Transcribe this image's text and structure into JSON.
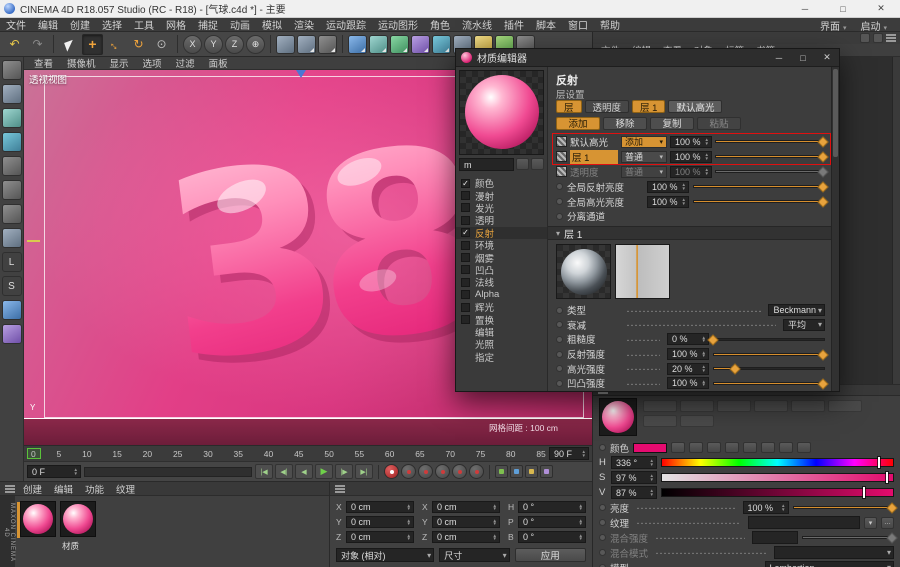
{
  "titlebar": {
    "title": "CINEMA 4D R18.057 Studio (RC - R18) - [气球.c4d *] - 主要",
    "min": "─",
    "max": "□",
    "close": "✕"
  },
  "menubar": {
    "items": [
      "文件",
      "编辑",
      "创建",
      "选择",
      "工具",
      "网格",
      "捕捉",
      "动画",
      "模拟",
      "渲染",
      "运动跟踪",
      "运动图形",
      "角色",
      "流水线",
      "插件",
      "脚本",
      "窗口",
      "帮助"
    ],
    "right_items": [
      "界面",
      "启动"
    ]
  },
  "toolbar": {
    "axis": [
      "X",
      "Y",
      "Z"
    ],
    "left_letters": [
      "L",
      "S"
    ]
  },
  "viewport": {
    "menu_items": [
      "查看",
      "摄像机",
      "显示",
      "选项",
      "过滤",
      "面板"
    ],
    "view_label": "透视视图",
    "axis_label": "Y",
    "balloon_text": "38",
    "grid_text": "网格间距 : 100 cm"
  },
  "timeline": {
    "ticks": [
      "0",
      "5",
      "10",
      "15",
      "20",
      "25",
      "30",
      "35",
      "40",
      "45",
      "50",
      "55",
      "60",
      "65",
      "70",
      "75",
      "80",
      "85"
    ],
    "end_field": "90 F",
    "current_field": "0 F",
    "transport": [
      {
        "glyph": "|◀",
        "cls": "tbtn"
      },
      {
        "glyph": "◀|",
        "cls": "tbtn"
      },
      {
        "glyph": "◀",
        "cls": "tbtn"
      },
      {
        "glyph": "▶",
        "cls": "tbtn play"
      },
      {
        "glyph": "|▶",
        "cls": "tbtn"
      },
      {
        "glyph": "▶|",
        "cls": "tbtn"
      }
    ],
    "records": [
      {
        "cls": "rec on"
      },
      {
        "cls": "rec"
      },
      {
        "cls": "rec"
      },
      {
        "cls": "rec"
      },
      {
        "cls": "rec"
      },
      {
        "cls": "rec"
      }
    ],
    "toggles": [
      {
        "cls": "tgl g"
      },
      {
        "cls": "tgl b"
      },
      {
        "cls": "tgl y"
      },
      {
        "cls": "tgl p"
      }
    ]
  },
  "material_manager": {
    "tabs": [
      "创建",
      "编辑",
      "功能",
      "纹理"
    ],
    "logo": "MAXON CINEMA 4D",
    "material_caption": "材质"
  },
  "coordinates": {
    "fields": [
      {
        "label": "X",
        "value": "0 cm"
      },
      {
        "label": "X",
        "value": "0 cm"
      },
      {
        "label": "H",
        "value": "0 °"
      },
      {
        "label": "Y",
        "value": "0 cm"
      },
      {
        "label": "Y",
        "value": "0 cm"
      },
      {
        "label": "P",
        "value": "0 °"
      },
      {
        "label": "Z",
        "value": "0 cm"
      },
      {
        "label": "Z",
        "value": "0 cm"
      },
      {
        "label": "B",
        "value": "0 °"
      }
    ],
    "mode_dropdown": "对象 (相对)",
    "size_dropdown": "尺寸",
    "apply_button": "应用"
  },
  "right_panel": {
    "menu_items": [
      "文件",
      "编辑",
      "查看",
      "对象",
      "标签",
      "书签"
    ],
    "color": {
      "title": "颜色",
      "hsv": [
        {
          "label": "H",
          "value": "336 °",
          "barcls": "gradbar hue",
          "marker": "left:93.3%"
        },
        {
          "label": "S",
          "value": "97 %",
          "barcls": "gradbar sat",
          "marker": "left:97%"
        },
        {
          "label": "V",
          "value": "87 %",
          "barcls": "gradbar val",
          "marker": "left:87%"
        }
      ],
      "brightness_label": "亮度",
      "brightness_value": "100 %",
      "brightness_fill": "width:100%",
      "texture_label": "纹理",
      "mix_strength_label": "混合强度",
      "mix_strength_fill": "width:100%",
      "mix_mode_label": "混合模式",
      "model_label": "模型",
      "model_value": "Lambertian"
    }
  },
  "material_editor": {
    "title": "材质编辑器",
    "min": "─",
    "max": "□",
    "close": "✕",
    "material_name": "m",
    "channels": [
      {
        "label": "颜色",
        "box": "✓",
        "cls": "chrow"
      },
      {
        "label": "漫射",
        "box": "",
        "cls": "chrow"
      },
      {
        "label": "发光",
        "box": "",
        "cls": "chrow"
      },
      {
        "label": "透明",
        "box": "",
        "cls": "chrow"
      },
      {
        "label": "反射",
        "box": "✓",
        "cls": "chrow sel"
      },
      {
        "label": "环境",
        "box": "",
        "cls": "chrow"
      },
      {
        "label": "烟雾",
        "box": "",
        "cls": "chrow"
      },
      {
        "label": "凹凸",
        "box": "",
        "cls": "chrow"
      },
      {
        "label": "法线",
        "box": "",
        "cls": "chrow"
      },
      {
        "label": "Alpha",
        "box": "",
        "cls": "chrow"
      },
      {
        "label": "辉光",
        "box": "",
        "cls": "chrow"
      },
      {
        "label": "置换",
        "box": "",
        "cls": "chrow"
      },
      {
        "label": "编辑",
        "cls": "chrow nobox"
      },
      {
        "label": "光照",
        "cls": "chrow nobox"
      },
      {
        "label": "指定",
        "cls": "chrow nobox"
      }
    ],
    "reflectance": {
      "header": "反射",
      "layers_label": "层设置",
      "tabs": [
        {
          "label": "层",
          "cls": "rtab amber"
        },
        {
          "label": "透明度",
          "cls": "rtab"
        },
        {
          "label": "层 1",
          "cls": "rtab amber"
        },
        {
          "label": "默认高光",
          "cls": "rtab lite"
        }
      ],
      "buttons": [
        {
          "label": "添加",
          "cls": "rbtn amber"
        },
        {
          "label": "移除",
          "cls": "rbtn"
        },
        {
          "label": "复制",
          "cls": "rbtn"
        },
        {
          "label": "粘贴",
          "cls": "rbtn dim"
        }
      ],
      "layers": [
        {
          "cls": "lrow",
          "namecls": "lname",
          "name": "默认高光",
          "modecls": "ldrop amber",
          "mode": "添加",
          "value": "100 %",
          "fill": "width:100%"
        },
        {
          "cls": "lrow",
          "namecls": "lname hl",
          "name": "层 1",
          "modecls": "ldrop",
          "mode": "普通",
          "value": "100 %",
          "fill": "width:100%"
        },
        {
          "cls": "lrow dis",
          "namecls": "lname",
          "name": "透明度",
          "modecls": "ldrop",
          "mode": "普通",
          "value": "100 %",
          "fill": "width:100%"
        }
      ],
      "global_rows": [
        {
          "label": "全局反射亮度",
          "value": "100 %",
          "fill": "width:100%"
        },
        {
          "label": "全局高光亮度",
          "value": "100 %",
          "fill": "width:100%"
        }
      ],
      "separate_label": "分离通道",
      "layer1_header": "层 1",
      "type_label": "类型",
      "type_value": "Beckmann",
      "atten_label": "衰减",
      "atten_value": "平均",
      "strength_rows": [
        {
          "label": "粗糙度",
          "value": "0 %",
          "fill": "width:0%"
        },
        {
          "label": "反射强度",
          "value": "100 %",
          "fill": "width:100%"
        },
        {
          "label": "高光强度",
          "value": "20 %",
          "fill": "width:20%"
        },
        {
          "label": "凹凸强度",
          "value": "100 %",
          "fill": "width:100%"
        }
      ]
    }
  }
}
